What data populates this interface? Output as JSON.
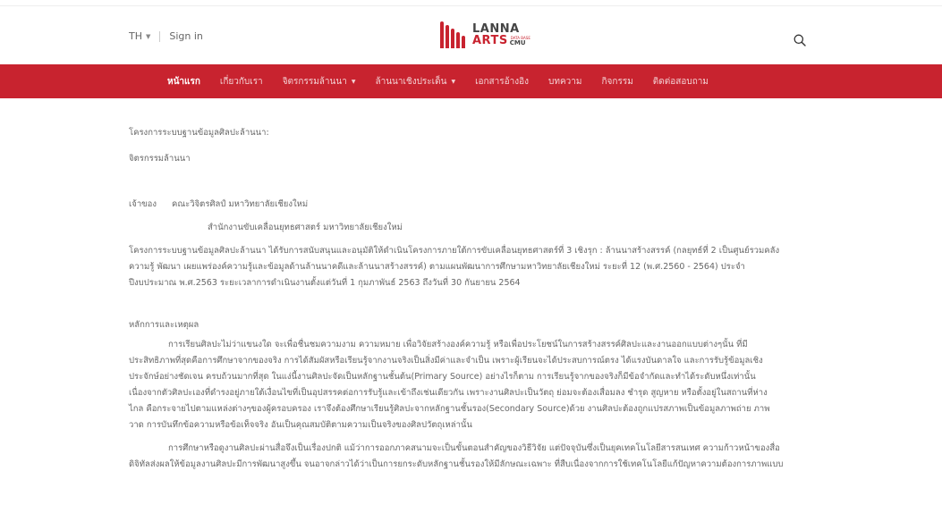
{
  "header": {
    "lang": "TH",
    "sign_in": "Sign in",
    "logo": {
      "line1": "LANNA",
      "line2": "ARTS",
      "sub": "DATA BASE",
      "cmu": "CMU"
    }
  },
  "nav": {
    "items": [
      {
        "label": "หน้าแรก"
      },
      {
        "label": "เกี่ยวกับเรา"
      },
      {
        "label": "จิตรกรรมล้านนา"
      },
      {
        "label": "ล้านนาเชิงประเด็น"
      },
      {
        "label": "เอกสารอ้างอิง"
      },
      {
        "label": "บทความ"
      },
      {
        "label": "กิจกรรม"
      },
      {
        "label": "ติดต่อสอบถาม"
      }
    ]
  },
  "content": {
    "project_label": "โครงการระบบฐานข้อมูลศิลปะล้านนา:",
    "project_name": "จิตรกรรมล้านนา",
    "owner_label": "เจ้าของ",
    "owner_1": "คณะวิจิตรศิลป์ มหาวิทยาลัยเชียงใหม่",
    "owner_2": "สำนักงานขับเคลื่อนยุทธศาสตร์ มหาวิทยาลัยเชียงใหม่",
    "summary_1": "โครงการระบบฐานข้อมูลศิลปะล้านนา ได้รับการสนับสนุนและอนุมัติให้ดำเนินโครงการภายใต้การขับเคลื่อนยุทธศาสตร์ที่ 3 เชิงรุก : ล้านนาสร้างสรรค์ (กลยุทธ์ที่ 2 เป็นศูนย์รวมคลัง",
    "summary_2": "ความรู้ พัฒนา เผยแพร่องค์ความรู้และข้อมูลด้านล้านนาคดีและล้านนาสร้างสรรค์) ตามแผนพัฒนาการศึกษามหาวิทยาลัยเชียงใหม่ ระยะที่ 12 (พ.ศ.2560 - 2564) ประจำ",
    "summary_3": "ปีงบประมาณ พ.ศ.2563  ระยะเวลาการดำเนินงานตั้งแต่วันที่ 1 กุมภาพันธ์ 2563 ถึงวันที่ 30 กันยายน 2564",
    "rationale_title": "หลักการและเหตุผล",
    "rationale_1": "การเรียนศิลปะไม่ว่าแขนงใด จะเพื่อชื่นชมความงาม ความหมาย เพื่อวิจัยสร้างองค์ความรู้ หรือเพื่อประโยชน์ในการสร้างสรรค์ศิลปะและงานออกแบบต่างๆนั้น ที่มี",
    "rationale_2": "ประสิทธิภาพที่สุดคือการศึกษาจากของจริง การได้สัมผัสหรือเรียนรู้จากงานจริงเป็นสิ่งมีค่าและจำเป็น เพราะผู้เรียนจะได้ประสบการณ์ตรง ได้แรงบันดาลใจ และการรับรู้ข้อมูลเชิง",
    "rationale_3": "ประจักษ์อย่างชัดเจน ครบถ้วนมากที่สุด ในแง่นี้งานศิลปะจัดเป็นหลักฐานชั้นต้น(Primary Source) อย่างไรก็ตาม การเรียนรู้จากของจริงก็มีข้อจำกัดและทำได้ระดับหนึ่งเท่านั้น",
    "rationale_4": "เนื่องจากตัวศิลปะเองที่ดำรงอยู่ภายใต้เงื่อนไขที่เป็นอุปสรรคต่อการรับรู้และเข้าถึงเช่นเดียวกัน เพราะงานศิลปะเป็นวัตถุ ย่อมจะต้องเสื่อมลง ชำรุด สูญหาย หรือตั้งอยู่ในสถานที่ห่าง",
    "rationale_5": "ไกล คือกระจายไปตามแหล่งต่างๆของผู้ครอบครอง เราจึงต้องศึกษาเรียนรู้ศิลปะจากหลักฐานชั้นรอง(Secondary Source)ด้วย งานศิลปะต้องถูกแปรสภาพเป็นข้อมูลภาพถ่าย ภาพ",
    "rationale_6": "วาด การบันทึกข้อความหรือข้อเท็จจริง อันเป็นคุณสมบัติตามความเป็นจริงของศิลปวัตถุเหล่านั้น",
    "rationale_7": "การศึกษาหรือดูงานศิลปะผ่านสื่อจึงเป็นเรื่องปกติ แม้ว่าการออกภาคสนามจะเป็นขั้นตอนสำคัญของวิธีวิจัย แต่ปัจจุบันซึ่งเป็นยุคเทคโนโลยีสารสนเทศ ความก้าวหน้าของสื่อ",
    "rationale_8": "ดิจิทัลส่งผลให้ข้อมูลงานศิลปะมีการพัฒนาสูงขึ้น จนอาจกล่าวได้ว่าเป็นการยกระดับหลักฐานชั้นรองให้มีลักษณะเฉพาะ ที่สืบเนื่องจากการใช้เทคโนโลยีแก้ปัญหาความต้องการภาพแบบ"
  }
}
